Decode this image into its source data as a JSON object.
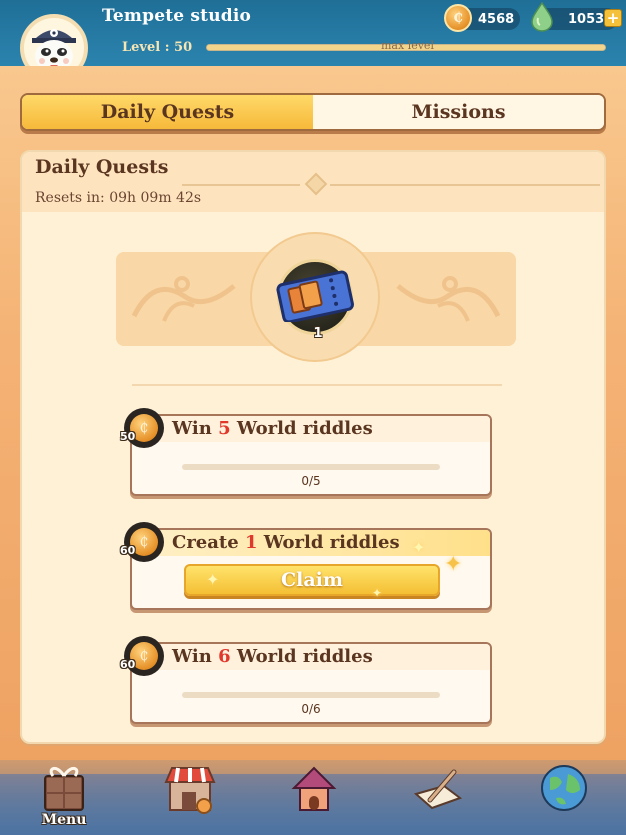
{
  "player": {
    "name": "Tempete studio",
    "level_label": "Level : 50",
    "level_progress_text": "max level",
    "level_progress": 1.0
  },
  "currency": {
    "coins": "4568",
    "drops": "1053",
    "coin_symbol": "₵",
    "plus": "+"
  },
  "tabs": [
    {
      "label": "Daily Quests",
      "active": true
    },
    {
      "label": "Missions",
      "active": false
    }
  ],
  "daily": {
    "title": "Daily Quests",
    "reset_text": "Resets in: 09h 09m 42s",
    "reward_count": "1"
  },
  "quests": [
    {
      "pre": "Win ",
      "num": "5",
      "post": " World riddles",
      "reward": "50",
      "progress_text": "0/5",
      "progress": 0.0,
      "claimable": false
    },
    {
      "pre": "Create ",
      "num": "1",
      "post": " World riddles",
      "reward": "60",
      "claim_label": "Claim",
      "claimable": true
    },
    {
      "pre": "Win ",
      "num": "6",
      "post": " World riddles",
      "reward": "60",
      "progress_text": "0/6",
      "progress": 0.0,
      "claimable": false
    }
  ],
  "nav": {
    "menu_label": "Menu"
  },
  "colors": {
    "accent_yellow": "#f6b93a",
    "highlight_red": "#e0382b",
    "panel_bg": "#fff1d6",
    "topbar_blue": "#2b84ae"
  }
}
